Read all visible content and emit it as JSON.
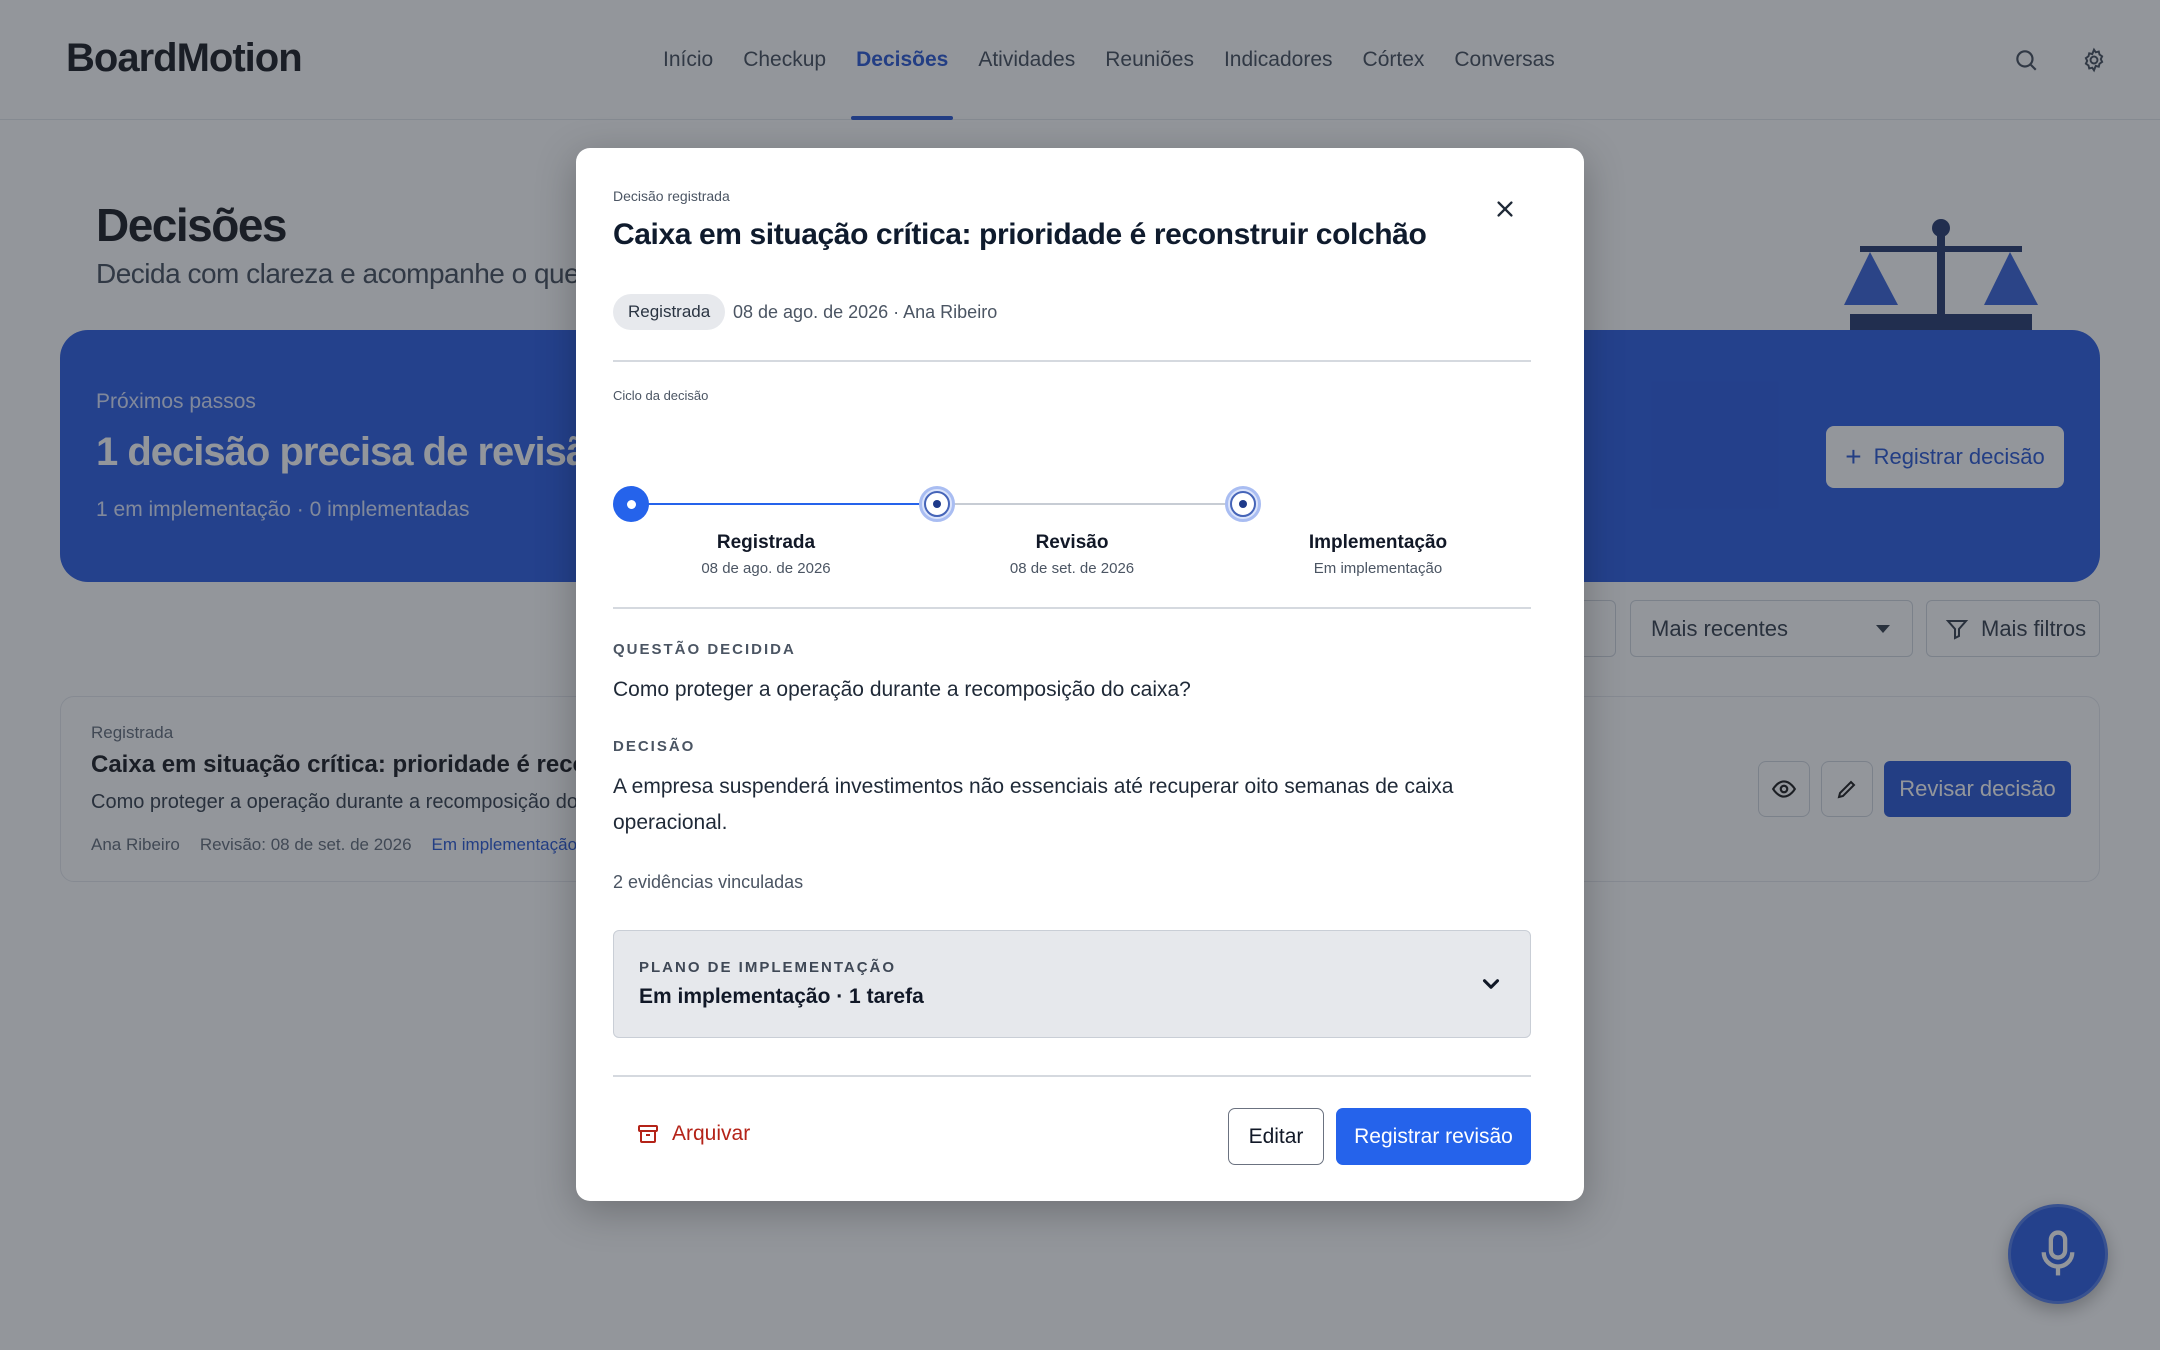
{
  "app": {
    "brand": "BoardMotion",
    "nav": [
      {
        "label": "Início"
      },
      {
        "label": "Checkup"
      },
      {
        "label": "Decisões"
      },
      {
        "label": "Atividades"
      },
      {
        "label": "Reuniões"
      },
      {
        "label": "Indicadores"
      },
      {
        "label": "Córtex"
      },
      {
        "label": "Conversas"
      }
    ],
    "active_nav": "Decisões",
    "icons": {
      "search": "search-icon",
      "settings": "gear-icon"
    }
  },
  "page": {
    "title": "Decisões",
    "subtitle": "Decida com clareza e acompanhe o que foi d",
    "hero": {
      "kicker": "Próximos passos",
      "title": "1 decisão precisa de revisão",
      "meta": "1 em implementação · 0 implementadas",
      "button_label": "Registrar decisão"
    },
    "filters": {
      "sort_label": "Mais recentes",
      "more_filters_label": "Mais filtros"
    },
    "list": [
      {
        "status": "Registrada",
        "title": "Caixa em situação crítica: prioridade é recons",
        "question": "Como proteger a operação durante a recomposição do ca",
        "author": "Ana Ribeiro",
        "review": "Revisão: 08 de set. de 2026",
        "implementation": "Em implementação",
        "review_button": "Revisar decisão"
      }
    ]
  },
  "modal": {
    "kicker": "Decisão registrada",
    "title": "Caixa em situação crítica: prioridade é reconstruir colchão",
    "badge": "Registrada",
    "meta": "08 de ago. de 2026 · Ana Ribeiro",
    "cycle_label": "Ciclo da decisão",
    "timeline": [
      {
        "label": "Registrada",
        "sub": "08 de ago. de 2026",
        "state": "done"
      },
      {
        "label": "Revisão",
        "sub": "08 de set. de 2026",
        "state": "pending"
      },
      {
        "label": "Implementação",
        "sub": "Em implementação",
        "state": "pending"
      }
    ],
    "question_label": "QUESTÃO DECIDIDA",
    "question": "Como proteger a operação durante a recomposição do caixa?",
    "decision_label": "DECISÃO",
    "decision": "A empresa suspenderá investimentos não essenciais até recuperar oito semanas de caixa operacional.",
    "evidence": "2 evidências vinculadas",
    "plan_label": "PLANO DE IMPLEMENTAÇÃO",
    "plan_value": "Em implementação · 1 tarefa",
    "archive_label": "Arquivar",
    "edit_label": "Editar",
    "primary_label": "Registrar revisão"
  },
  "colors": {
    "accent": "#2054e0",
    "primary_button": "#2563eb",
    "danger": "#b42318"
  }
}
